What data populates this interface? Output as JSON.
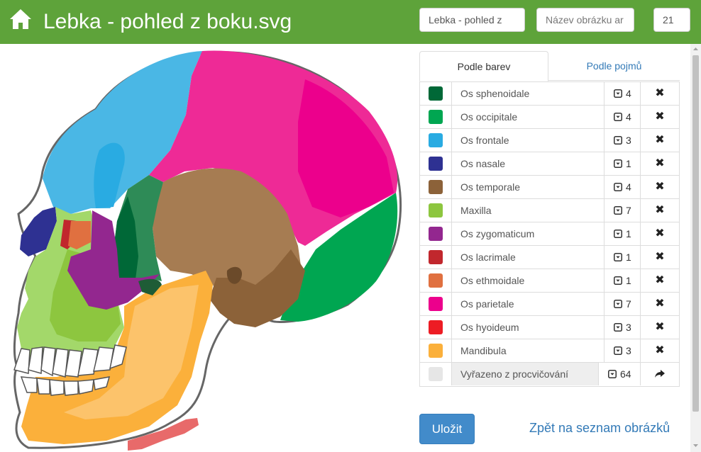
{
  "header": {
    "title": "Lebka - pohled z boku.svg",
    "name_input_value": "Lebka - pohled z",
    "description_placeholder": "Název obrázku ar",
    "count_value": "21"
  },
  "tabs": {
    "by_color": "Podle barev",
    "by_term": "Podle pojmů"
  },
  "legend": [
    {
      "name": "Os sphenoidale",
      "color": "#006837",
      "count": "4"
    },
    {
      "name": "Os occipitale",
      "color": "#00a651",
      "count": "4"
    },
    {
      "name": "Os frontale",
      "color": "#29abe2",
      "count": "3"
    },
    {
      "name": "Os nasale",
      "color": "#2e3192",
      "count": "1"
    },
    {
      "name": "Os temporale",
      "color": "#8c6239",
      "count": "4"
    },
    {
      "name": "Maxilla",
      "color": "#8dc63f",
      "count": "7"
    },
    {
      "name": "Os zygomaticum",
      "color": "#93278f",
      "count": "1"
    },
    {
      "name": "Os lacrimale",
      "color": "#c1272d",
      "count": "1"
    },
    {
      "name": "Os ethmoidale",
      "color": "#e07040",
      "count": "1"
    },
    {
      "name": "Os parietale",
      "color": "#ec008c",
      "count": "7"
    },
    {
      "name": "Os hyoideum",
      "color": "#ed1c24",
      "count": "3"
    },
    {
      "name": "Mandibula",
      "color": "#fbb03b",
      "count": "3"
    }
  ],
  "excluded": {
    "name": "Vyřazeno z procvičování",
    "color": "#e6e6e6",
    "count": "64"
  },
  "icons": {
    "home": "home-icon",
    "remove": "close-icon",
    "dropdown": "caret-square-down-icon",
    "restore": "share-arrow-icon"
  },
  "actions": {
    "save": "Uložit",
    "back": "Zpět na seznam obrázků"
  },
  "colors": {
    "header_bg": "#5ea33a",
    "primary": "#428bca",
    "link": "#337ab7"
  }
}
